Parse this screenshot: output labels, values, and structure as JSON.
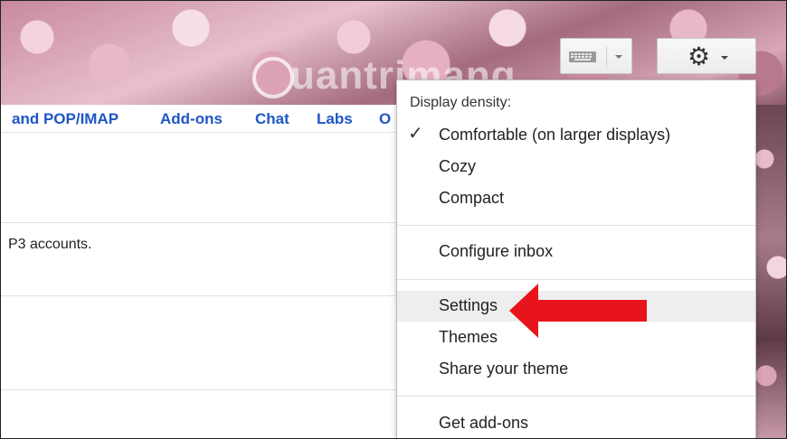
{
  "app": {
    "tabs": [
      {
        "label": "and POP/IMAP"
      },
      {
        "label": "Add-ons"
      },
      {
        "label": "Chat"
      },
      {
        "label": "Labs"
      },
      {
        "label": "O"
      }
    ],
    "body_text": "P3 accounts."
  },
  "watermark": {
    "text": "uantrimang"
  },
  "toolbar": {
    "keyboard_icon": "keyboard-icon",
    "gear_icon": "gear-icon",
    "gear_glyph": "⚙"
  },
  "menu": {
    "header": "Display density:",
    "check_glyph": "✓",
    "items": [
      {
        "label": "Comfortable (on larger displays)",
        "checked": true
      },
      {
        "label": "Cozy"
      },
      {
        "label": "Compact"
      },
      {
        "label": "Configure inbox"
      },
      {
        "label": "Settings",
        "highlighted": true
      },
      {
        "label": "Themes"
      },
      {
        "label": "Share your theme"
      },
      {
        "label": "Get add-ons"
      }
    ]
  },
  "colors": {
    "link_blue": "#1f56c6",
    "highlight": "#eeeeee",
    "arrow_red": "#e8141b"
  }
}
